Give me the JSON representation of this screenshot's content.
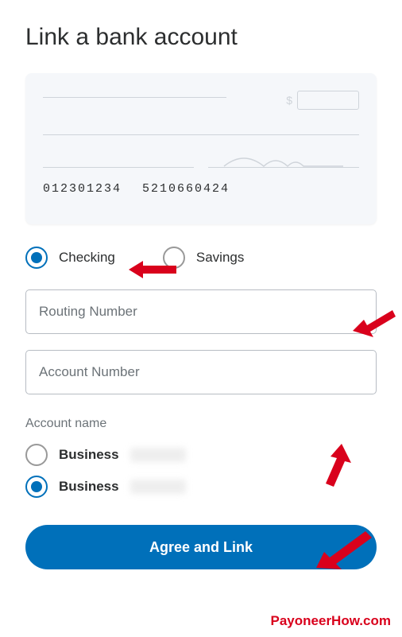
{
  "title": "Link a bank account",
  "check": {
    "routing_sample": "012301234",
    "account_sample": "5210660424",
    "currency_symbol": "$"
  },
  "account_type": {
    "checking_label": "Checking",
    "savings_label": "Savings",
    "selected": "checking"
  },
  "inputs": {
    "routing_placeholder": "Routing Number",
    "routing_value": "",
    "account_placeholder": "Account Number",
    "account_value": ""
  },
  "account_name": {
    "section_label": "Account name",
    "option1_label": "Business",
    "option2_label": "Business",
    "selected": "option2"
  },
  "button": {
    "primary_label": "Agree and Link"
  },
  "watermark": "PayoneerHow.com",
  "colors": {
    "primary": "#0070ba",
    "accent_red": "#d9011c"
  }
}
